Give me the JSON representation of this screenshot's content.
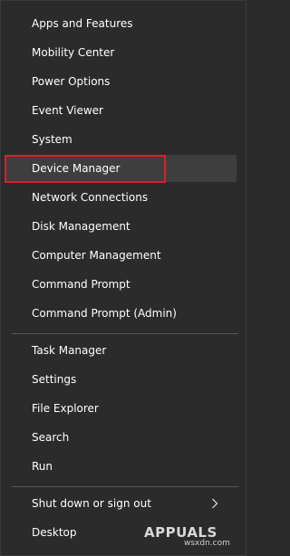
{
  "menu": {
    "group1": [
      {
        "label": "Apps and Features"
      },
      {
        "label": "Mobility Center"
      },
      {
        "label": "Power Options"
      },
      {
        "label": "Event Viewer"
      },
      {
        "label": "System"
      },
      {
        "label": "Device Manager"
      },
      {
        "label": "Network Connections"
      },
      {
        "label": "Disk Management"
      },
      {
        "label": "Computer Management"
      },
      {
        "label": "Command Prompt"
      },
      {
        "label": "Command Prompt (Admin)"
      }
    ],
    "group2": [
      {
        "label": "Task Manager"
      },
      {
        "label": "Settings"
      },
      {
        "label": "File Explorer"
      },
      {
        "label": "Search"
      },
      {
        "label": "Run"
      }
    ],
    "group3": [
      {
        "label": "Shut down or sign out",
        "icon": "chevron-right-icon"
      },
      {
        "label": "Desktop"
      }
    ]
  },
  "watermark": {
    "logo": "APPUALS",
    "site": "wsxdn.com"
  },
  "colors": {
    "background": "#2b2b2b",
    "text": "#ffffff",
    "highlight_border": "#d8202b",
    "separator": "#585858"
  }
}
